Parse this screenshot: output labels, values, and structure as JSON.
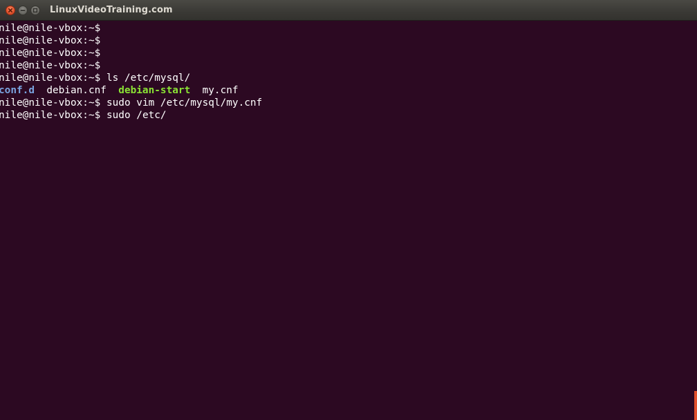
{
  "window": {
    "title": "LinuxVideoTraining.com",
    "colors": {
      "background": "#2c0922",
      "text": "#ffffff",
      "directory": "#7aa4e0",
      "executable": "#8ae234",
      "close_button": "#e2532e"
    }
  },
  "terminal": {
    "prompt": "nile@nile-vbox:~$",
    "lines": [
      {
        "prompt": "nile@nile-vbox:~$",
        "command": ""
      },
      {
        "prompt": "nile@nile-vbox:~$",
        "command": ""
      },
      {
        "prompt": "nile@nile-vbox:~$",
        "command": ""
      },
      {
        "prompt": "nile@nile-vbox:~$",
        "command": ""
      },
      {
        "prompt": "nile@nile-vbox:~$",
        "command": " ls /etc/mysql/"
      },
      {
        "prompt": "nile@nile-vbox:~$",
        "command": " sudo vim /etc/mysql/my.cnf"
      },
      {
        "prompt": "nile@nile-vbox:~$",
        "command": " sudo /etc/"
      }
    ],
    "ls_output": {
      "dir": "conf.d",
      "file1": "debian.cnf",
      "exec": "debian-start",
      "file2": "my.cnf"
    }
  }
}
